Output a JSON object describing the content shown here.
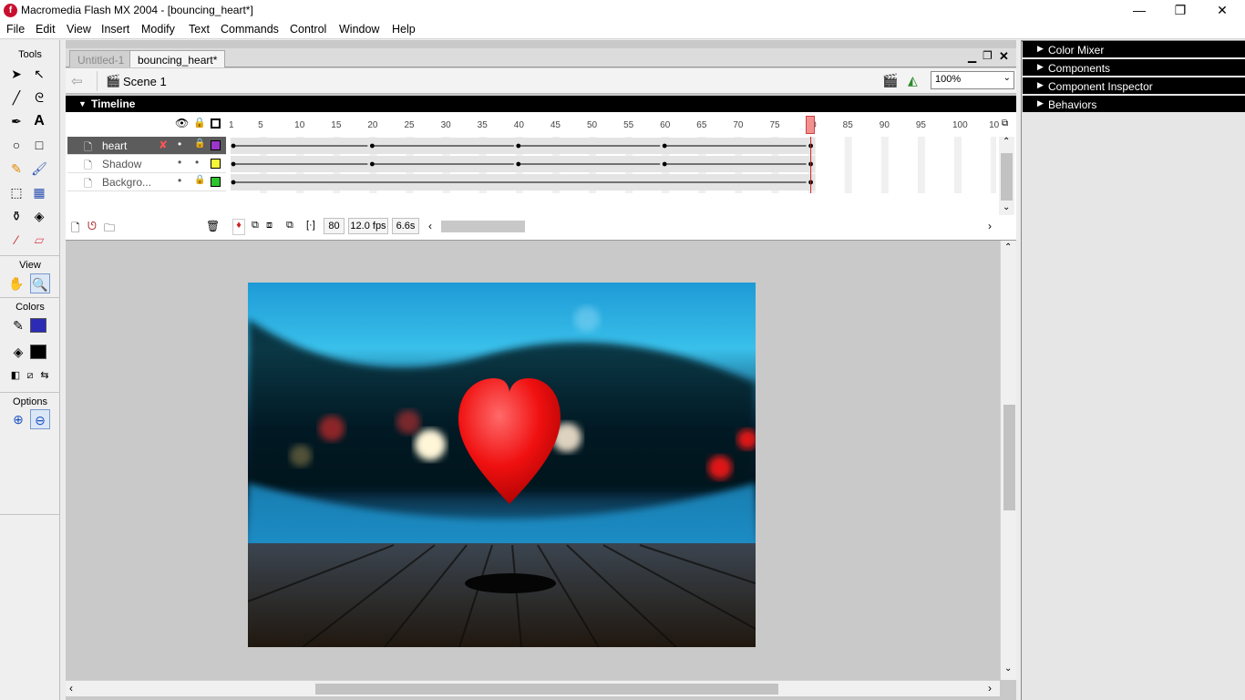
{
  "window": {
    "title": "Macromedia Flash MX 2004 - [bouncing_heart*]",
    "minimize": "—",
    "maximize": "❐",
    "close": "✕"
  },
  "menu": [
    "File",
    "Edit",
    "View",
    "Insert",
    "Modify",
    "Text",
    "Commands",
    "Control",
    "Window",
    "Help"
  ],
  "tools": {
    "section_tools": "Tools",
    "section_view": "View",
    "section_colors": "Colors",
    "section_options": "Options",
    "stroke_color": "#2b2bb5",
    "fill_color": "#000000"
  },
  "document": {
    "tabs": [
      {
        "label": "Untitled-1",
        "active": false
      },
      {
        "label": "bouncing_heart*",
        "active": true
      }
    ],
    "scene": "Scene 1",
    "zoom": "100%"
  },
  "timeline": {
    "header": "Timeline",
    "ruler_labels": [
      "1",
      "5",
      "10",
      "15",
      "20",
      "25",
      "30",
      "35",
      "40",
      "45",
      "50",
      "55",
      "60",
      "65",
      "70",
      "75",
      "80",
      "85",
      "90",
      "95",
      "100",
      "10"
    ],
    "layers": [
      {
        "name": "heart",
        "selected": true,
        "color": "#9a36c8"
      },
      {
        "name": "Shadow",
        "selected": false,
        "color": "#f5f53a"
      },
      {
        "name": "Backgro...",
        "selected": false,
        "color": "#2ec42e"
      }
    ],
    "current_frame": "80",
    "fps": "12.0 fps",
    "elapsed": "6.6s"
  },
  "panels": [
    {
      "label": "Color Mixer"
    },
    {
      "label": "Components"
    },
    {
      "label": "Component Inspector"
    },
    {
      "label": "Behaviors"
    }
  ]
}
